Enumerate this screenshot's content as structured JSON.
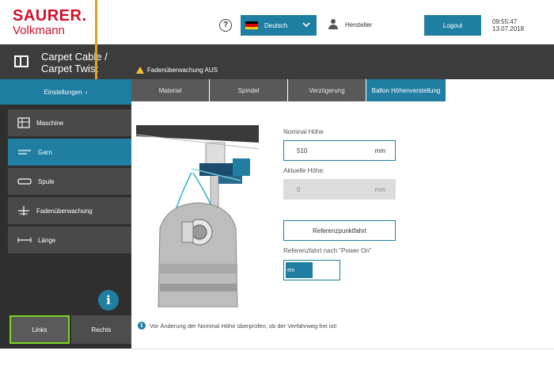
{
  "brand": {
    "name": "SAURER.",
    "subname": "Volkmann",
    "accent": "#d0112b"
  },
  "header": {
    "help_icon": "?",
    "language": "Deutsch",
    "user": "Hersteller",
    "logout": "Logout",
    "time": "09:55:47",
    "date": "13.07.2018"
  },
  "titlebar": {
    "title_line1": "Carpet Cable /",
    "title_line2": "Carpet Twist",
    "warning": "Fadenüberwachung AUS"
  },
  "sidebar": {
    "settings_label": "Einstellungen",
    "settings_chevron": "›",
    "items": [
      {
        "label": "Maschine",
        "icon": "machine-icon",
        "active": false
      },
      {
        "label": "Garn",
        "icon": "yarn-icon",
        "active": true
      },
      {
        "label": "Spule",
        "icon": "spool-icon",
        "active": false
      },
      {
        "label": "Fadenüberwachung",
        "icon": "thread-monitor-icon",
        "active": false
      },
      {
        "label": "Länge",
        "icon": "length-icon",
        "active": false
      }
    ],
    "info_icon": "i",
    "footer": {
      "left": "Links",
      "right": "Rechts"
    }
  },
  "tabs": [
    {
      "label": "Material",
      "active": false
    },
    {
      "label": "Spindel",
      "active": false
    },
    {
      "label": "Verzögerung",
      "active": false
    },
    {
      "label": "Ballon Höhenverstellung",
      "active": true
    }
  ],
  "form": {
    "nominal_label": "Nominal Höhe",
    "nominal_value": "510",
    "nominal_unit": "mm",
    "actual_label": "Aktuelle Höhe:",
    "actual_value": "0",
    "actual_unit": "mm",
    "reference_button": "Referenzpunktfahrt",
    "power_on_label": "Referenzfahrt nach \"Power On\"",
    "toggle_text": "ein"
  },
  "note": "Vor Änderung der Nominal Höhe überprüfen, ob der Verfahrweg frei ist!",
  "colors": {
    "primary": "#1f7ea1",
    "dark": "#3c3c3c",
    "selected_outline": "#7ed321",
    "warning": "#f1c232"
  }
}
